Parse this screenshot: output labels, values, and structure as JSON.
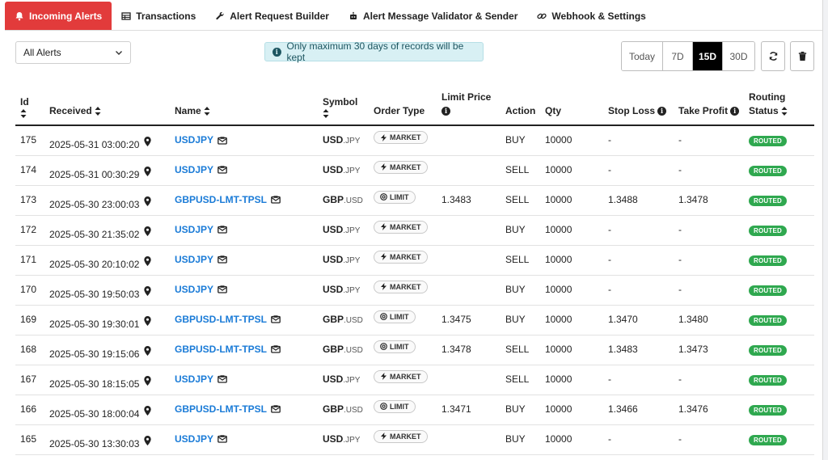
{
  "tabs": [
    {
      "label": "Incoming Alerts",
      "icon": "bell-icon",
      "active": true
    },
    {
      "label": "Transactions",
      "icon": "table-icon",
      "active": false
    },
    {
      "label": "Alert Request Builder",
      "icon": "wrench-icon",
      "active": false
    },
    {
      "label": "Alert Message Validator & Sender",
      "icon": "robot-icon",
      "active": false
    },
    {
      "label": "Webhook & Settings",
      "icon": "link-icon",
      "active": false
    }
  ],
  "filter": {
    "selected": "All Alerts"
  },
  "notice": {
    "text": "Only maximum 30 days of records will be kept"
  },
  "range": {
    "options": [
      "Today",
      "7D",
      "15D",
      "30D"
    ],
    "selected": "15D"
  },
  "columns": {
    "id": "Id",
    "received": "Received",
    "name": "Name",
    "symbol": "Symbol",
    "order_type": "Order Type",
    "limit_price": "Limit Price",
    "action": "Action",
    "qty": "Qty",
    "stop_loss": "Stop Loss",
    "take_profit": "Take Profit",
    "routing": "Routing",
    "status": "Status"
  },
  "rows": [
    {
      "id": "175",
      "received": "2025-05-31 03:00:20",
      "name": "USDJPY",
      "sym_base": "USD",
      "sym_quote": ".JPY",
      "order_type": "MARKET",
      "limit_price": "",
      "action": "BUY",
      "qty": "10000",
      "stop_loss": "-",
      "take_profit": "-",
      "status": "ROUTED"
    },
    {
      "id": "174",
      "received": "2025-05-31 00:30:29",
      "name": "USDJPY",
      "sym_base": "USD",
      "sym_quote": ".JPY",
      "order_type": "MARKET",
      "limit_price": "",
      "action": "SELL",
      "qty": "10000",
      "stop_loss": "-",
      "take_profit": "-",
      "status": "ROUTED"
    },
    {
      "id": "173",
      "received": "2025-05-30 23:00:03",
      "name": "GBPUSD-LMT-TPSL",
      "sym_base": "GBP",
      "sym_quote": ".USD",
      "order_type": "LIMIT",
      "limit_price": "1.3483",
      "action": "SELL",
      "qty": "10000",
      "stop_loss": "1.3488",
      "take_profit": "1.3478",
      "status": "ROUTED"
    },
    {
      "id": "172",
      "received": "2025-05-30 21:35:02",
      "name": "USDJPY",
      "sym_base": "USD",
      "sym_quote": ".JPY",
      "order_type": "MARKET",
      "limit_price": "",
      "action": "BUY",
      "qty": "10000",
      "stop_loss": "-",
      "take_profit": "-",
      "status": "ROUTED"
    },
    {
      "id": "171",
      "received": "2025-05-30 20:10:02",
      "name": "USDJPY",
      "sym_base": "USD",
      "sym_quote": ".JPY",
      "order_type": "MARKET",
      "limit_price": "",
      "action": "SELL",
      "qty": "10000",
      "stop_loss": "-",
      "take_profit": "-",
      "status": "ROUTED"
    },
    {
      "id": "170",
      "received": "2025-05-30 19:50:03",
      "name": "USDJPY",
      "sym_base": "USD",
      "sym_quote": ".JPY",
      "order_type": "MARKET",
      "limit_price": "",
      "action": "BUY",
      "qty": "10000",
      "stop_loss": "-",
      "take_profit": "-",
      "status": "ROUTED"
    },
    {
      "id": "169",
      "received": "2025-05-30 19:30:01",
      "name": "GBPUSD-LMT-TPSL",
      "sym_base": "GBP",
      "sym_quote": ".USD",
      "order_type": "LIMIT",
      "limit_price": "1.3475",
      "action": "BUY",
      "qty": "10000",
      "stop_loss": "1.3470",
      "take_profit": "1.3480",
      "status": "ROUTED"
    },
    {
      "id": "168",
      "received": "2025-05-30 19:15:06",
      "name": "GBPUSD-LMT-TPSL",
      "sym_base": "GBP",
      "sym_quote": ".USD",
      "order_type": "LIMIT",
      "limit_price": "1.3478",
      "action": "SELL",
      "qty": "10000",
      "stop_loss": "1.3483",
      "take_profit": "1.3473",
      "status": "ROUTED"
    },
    {
      "id": "167",
      "received": "2025-05-30 18:15:05",
      "name": "USDJPY",
      "sym_base": "USD",
      "sym_quote": ".JPY",
      "order_type": "MARKET",
      "limit_price": "",
      "action": "SELL",
      "qty": "10000",
      "stop_loss": "-",
      "take_profit": "-",
      "status": "ROUTED"
    },
    {
      "id": "166",
      "received": "2025-05-30 18:00:04",
      "name": "GBPUSD-LMT-TPSL",
      "sym_base": "GBP",
      "sym_quote": ".USD",
      "order_type": "LIMIT",
      "limit_price": "1.3471",
      "action": "BUY",
      "qty": "10000",
      "stop_loss": "1.3466",
      "take_profit": "1.3476",
      "status": "ROUTED"
    },
    {
      "id": "165",
      "received": "2025-05-30 13:30:03",
      "name": "USDJPY",
      "sym_base": "USD",
      "sym_quote": ".JPY",
      "order_type": "MARKET",
      "limit_price": "",
      "action": "BUY",
      "qty": "10000",
      "stop_loss": "-",
      "take_profit": "-",
      "status": "ROUTED"
    }
  ],
  "colors": {
    "accent": "#e23b3b",
    "link": "#1a7bd7",
    "routed": "#2fa84f",
    "notice_bg": "#d8f0f4"
  }
}
